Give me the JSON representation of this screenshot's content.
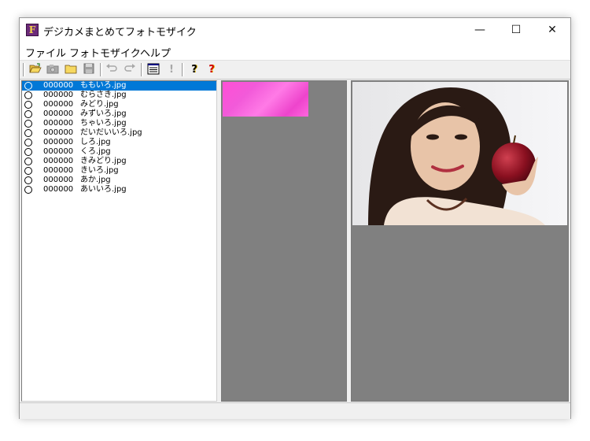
{
  "window": {
    "title": "デジカメまとめてフォトモザイク",
    "app_icon_letter": "F",
    "controls": {
      "minimize": "—",
      "maximize": "☐",
      "close": "✕"
    }
  },
  "menu": {
    "items": [
      "ファイル",
      "フォトモザイク",
      "ヘルプ"
    ]
  },
  "toolbar": {
    "icons": [
      "open-folder-icon",
      "camera-icon",
      "folder-icon",
      "save-icon",
      "undo-icon",
      "redo-icon",
      "list-icon",
      "exclamation-icon",
      "help-icon",
      "context-help-icon"
    ],
    "glyphs": {
      "help": "?",
      "context_help": "?",
      "exclamation": "!"
    }
  },
  "file_list": {
    "selected_index": 0,
    "rows": [
      {
        "count": "000000",
        "name": "ももいろ.jpg"
      },
      {
        "count": "000000",
        "name": "むらさき.jpg"
      },
      {
        "count": "000000",
        "name": "みどり.jpg"
      },
      {
        "count": "000000",
        "name": "みずいろ.jpg"
      },
      {
        "count": "000000",
        "name": "ちゃいろ.jpg"
      },
      {
        "count": "000000",
        "name": "だいだいいろ.jpg"
      },
      {
        "count": "000000",
        "name": "しろ.jpg"
      },
      {
        "count": "000000",
        "name": "くろ.jpg"
      },
      {
        "count": "000000",
        "name": "きみどり.jpg"
      },
      {
        "count": "000000",
        "name": "きいろ.jpg"
      },
      {
        "count": "000000",
        "name": "あか.jpg"
      },
      {
        "count": "000000",
        "name": "あいいろ.jpg"
      }
    ]
  },
  "colors": {
    "selection": "#0078d7",
    "pane_background": "#808080",
    "tile_pink": "#f25ad9"
  }
}
